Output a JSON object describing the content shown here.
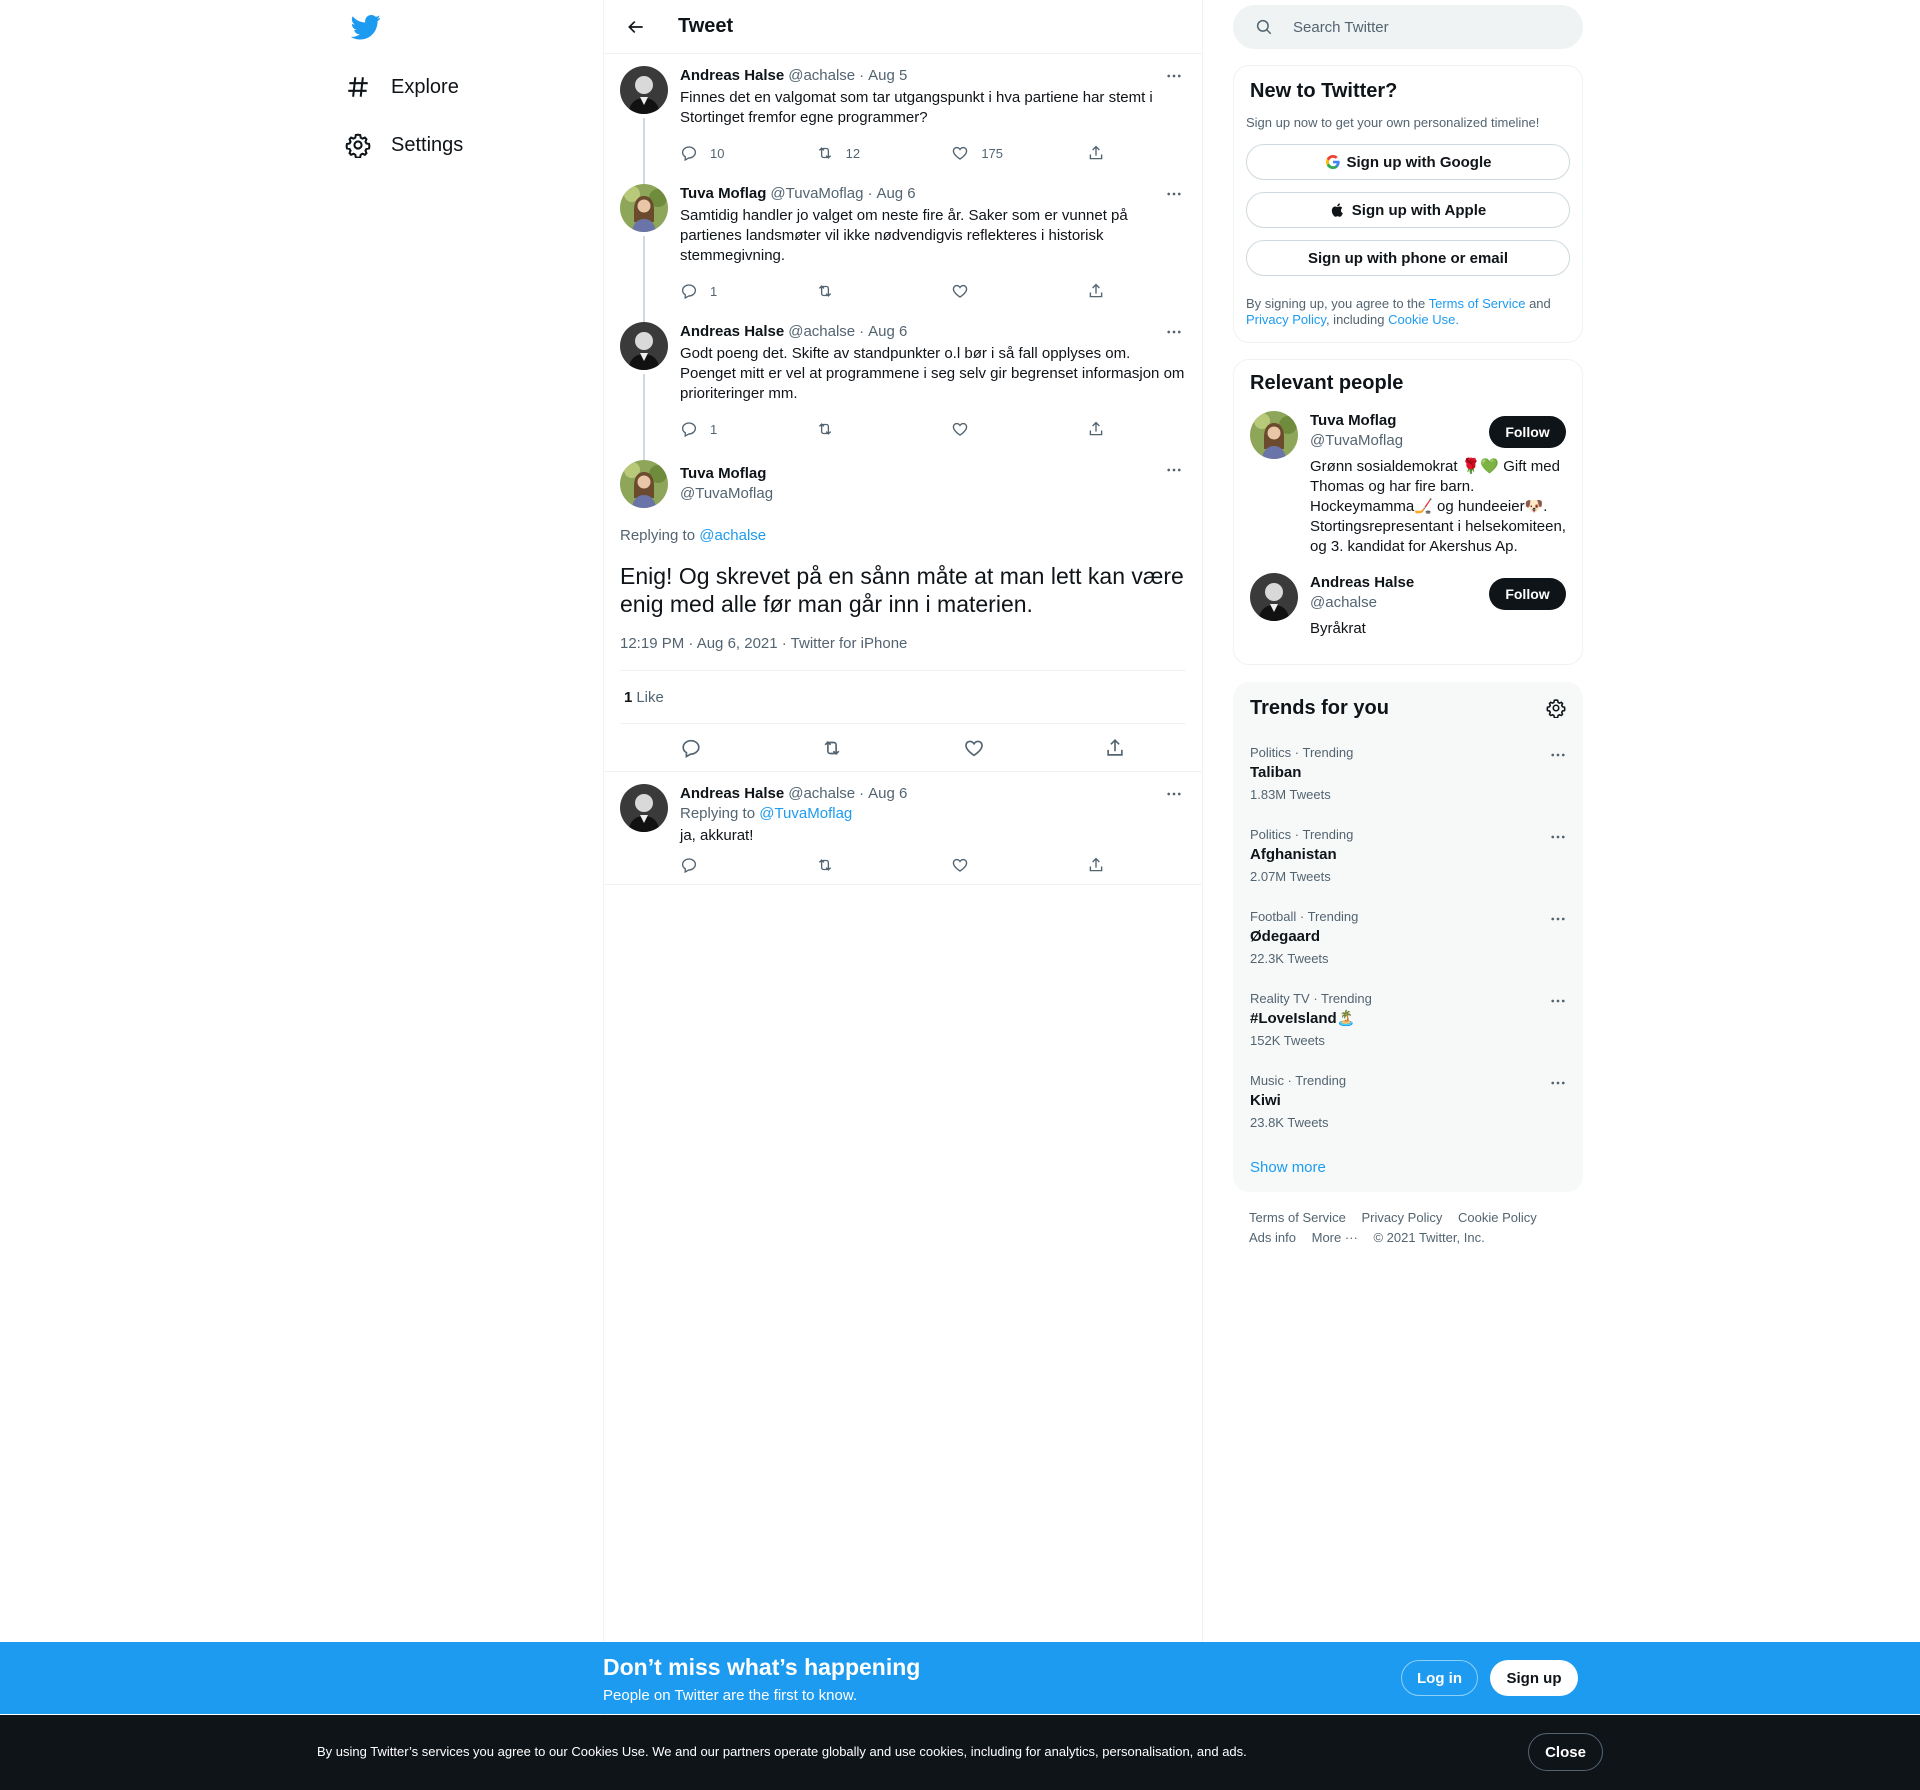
{
  "colors": {
    "accent": "#1d9bf0",
    "text": "#0f1419",
    "muted": "#536471",
    "border": "#eff3f4"
  },
  "nav": {
    "logo_icon": "twitter-bird-icon",
    "items": [
      {
        "label": "Explore",
        "icon": "hashtag-icon"
      },
      {
        "label": "Settings",
        "icon": "gear-icon"
      }
    ]
  },
  "header": {
    "title": "Tweet"
  },
  "thread": [
    {
      "name": "Andreas Halse",
      "handle": "@achalse",
      "date": "Aug 5",
      "text": "Finnes det en valgomat som tar utgangspunkt i hva partiene har stemt i Stortinget fremfor egne programmer?",
      "replies": "10",
      "retweets": "12",
      "likes": "175"
    },
    {
      "name": "Tuva Moflag",
      "handle": "@TuvaMoflag",
      "date": "Aug 6",
      "text": "Samtidig handler jo valget om neste fire år. Saker som er vunnet på partienes landsmøter vil ikke nødvendigvis reflekteres i historisk stemmegivning.",
      "replies": "1",
      "retweets": "",
      "likes": ""
    },
    {
      "name": "Andreas Halse",
      "handle": "@achalse",
      "date": "Aug 6",
      "text": "Godt poeng det. Skifte av standpunkter o.l bør i så fall opplyses om. Poenget mitt er vel at programmene i seg selv gir begrenset informasjon om prioriteringer mm.",
      "replies": "1",
      "retweets": "",
      "likes": ""
    }
  ],
  "main_tweet": {
    "name": "Tuva Moflag",
    "handle": "@TuvaMoflag",
    "replying_prefix": "Replying to",
    "replying_to": "@achalse",
    "text": "Enig! Og skrevet på en sånn måte at man lett kan være enig med alle før man går inn i materien.",
    "time": "12:19 PM · Aug 6, 2021 · Twitter for iPhone",
    "like_count": "1",
    "like_label": "Like"
  },
  "reply": {
    "name": "Andreas Halse",
    "handle": "@achalse",
    "date": "Aug 6",
    "replying_prefix": "Replying to",
    "replying_to": "@TuvaMoflag",
    "text": "ja, akkurat!"
  },
  "search": {
    "placeholder": "Search Twitter"
  },
  "new_to_twitter": {
    "title": "New to Twitter?",
    "subtitle": "Sign up now to get your own personalized timeline!",
    "google": "Sign up with Google",
    "apple": "Sign up with Apple",
    "phone": "Sign up with phone or email",
    "legal_1": "By signing up, you agree to the",
    "terms": "Terms of Service",
    "and": "and",
    "privacy": "Privacy Policy",
    "including": ", including",
    "cookie": "Cookie Use."
  },
  "relevant_people": {
    "title": "Relevant people",
    "people": [
      {
        "name": "Tuva Moflag",
        "handle": "@TuvaMoflag",
        "bio": "Grønn sosialdemokrat 🌹💚 Gift med Thomas og har fire barn. Hockeymamma🏒 og hundeeier🐶. Stortingsrepresentant i helsekomiteen, og 3. kandidat for Akershus Ap.",
        "follow": "Follow"
      },
      {
        "name": "Andreas Halse",
        "handle": "@achalse",
        "bio": "Byråkrat",
        "follow": "Follow"
      }
    ]
  },
  "trends": {
    "title": "Trends for you",
    "items": [
      {
        "meta": "Politics · Trending",
        "name": "Taliban",
        "count": "1.83M Tweets"
      },
      {
        "meta": "Politics · Trending",
        "name": "Afghanistan",
        "count": "2.07M Tweets"
      },
      {
        "meta": "Football · Trending",
        "name": "Ødegaard",
        "count": "22.3K Tweets"
      },
      {
        "meta": "Reality TV · Trending",
        "name": "#LoveIsland🏝️",
        "count": "152K Tweets"
      },
      {
        "meta": "Music · Trending",
        "name": "Kiwi",
        "count": "23.8K Tweets"
      }
    ],
    "show_more": "Show more"
  },
  "footer": {
    "terms": "Terms of Service",
    "privacy": "Privacy Policy",
    "cookie": "Cookie Policy",
    "ads": "Ads info",
    "more": "More ···",
    "copyright": "© 2021 Twitter, Inc."
  },
  "promo": {
    "title": "Don’t miss what’s happening",
    "subtitle": "People on Twitter are the first to know.",
    "login": "Log in",
    "signup": "Sign up"
  },
  "cookie_bar": {
    "text": "By using Twitter’s services you agree to our Cookies Use. We and our partners operate globally and use cookies, including for analytics, personalisation, and ads.",
    "close": "Close"
  }
}
